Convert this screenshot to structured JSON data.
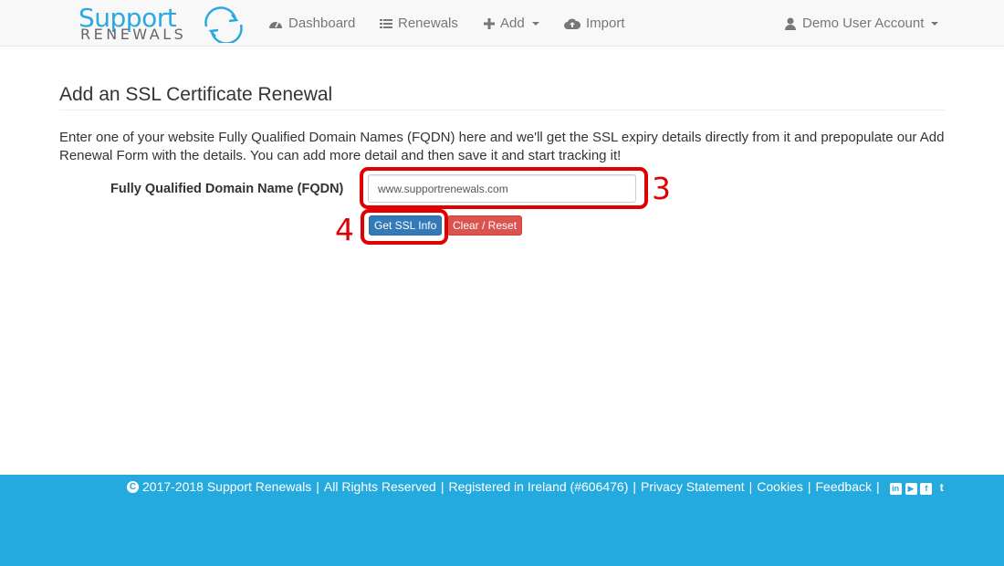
{
  "brand": {
    "line1": "Support",
    "line2": "RENEWALS"
  },
  "nav": {
    "dashboard": "Dashboard",
    "renewals": "Renewals",
    "add": "Add",
    "import": "Import",
    "account": "Demo User Account"
  },
  "main": {
    "title": "Add an SSL Certificate Renewal",
    "intro": "Enter one of your website Fully Qualified Domain Names (FQDN) here and we'll get the SSL expiry details directly from it and prepopulate our Add Renewal Form with the details. You can add more detail and then save it and start tracking it!",
    "fqdn_label": "Fully Qualified Domain Name (FQDN)",
    "fqdn_value": "www.supportrenewals.com",
    "get_ssl_button": "Get SSL Info",
    "clear_button": "Clear / Reset"
  },
  "annotations": {
    "step3": "3",
    "step4": "4"
  },
  "footer": {
    "copyright": "2017-2018 Support Renewals",
    "rights": "All Rights Reserved",
    "registered": "Registered in Ireland (#606476)",
    "privacy": "Privacy Statement",
    "cookies": "Cookies",
    "feedback": "Feedback",
    "separator": "|",
    "copyright_glyph": "C",
    "social_glyphs": {
      "linkedin": "in",
      "youtube": "▶",
      "facebook": "f",
      "twitter": "t"
    }
  },
  "colors": {
    "brand_blue": "#29a9df",
    "footer_bg": "#25aadf",
    "primary_button": "#337ab7",
    "danger_button": "#d9534f",
    "annotation_red": "#e00000"
  }
}
